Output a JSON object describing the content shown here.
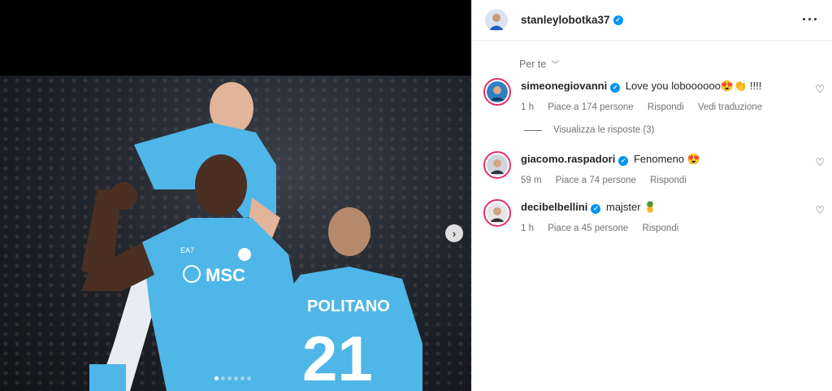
{
  "post": {
    "username": "stanleylobotka37",
    "more_icon": "more-horizontal-icon"
  },
  "media": {
    "jersey_sponsor": "MSC",
    "jersey_brand": "EA7",
    "player_name": "POLITANO",
    "player_number": "21",
    "carousel_total": 6,
    "carousel_active": 1
  },
  "comments_sort": {
    "label": "Per te"
  },
  "comments": [
    {
      "username": "simeonegiovanni",
      "text": "Love you loboooooo😍👏 !!!!",
      "time": "1 h",
      "likes": "Piace a 174 persone",
      "reply": "Rispondi",
      "translate": "Vedi traduzione",
      "view_replies": "Visualizza le risposte (3)"
    },
    {
      "username": "giacomo.raspadori",
      "text": "Fenomeno 😍",
      "time": "59 m",
      "likes": "Piace a 74 persone",
      "reply": "Rispondi"
    },
    {
      "username": "decibelbellini",
      "text": "majster 🍍",
      "time": "1 h",
      "likes": "Piace a 45 persone",
      "reply": "Rispondi"
    }
  ],
  "colors": {
    "verified": "#0095f6",
    "napoli_blue": "#4fb6e8",
    "story_ring": "#e1306c"
  }
}
